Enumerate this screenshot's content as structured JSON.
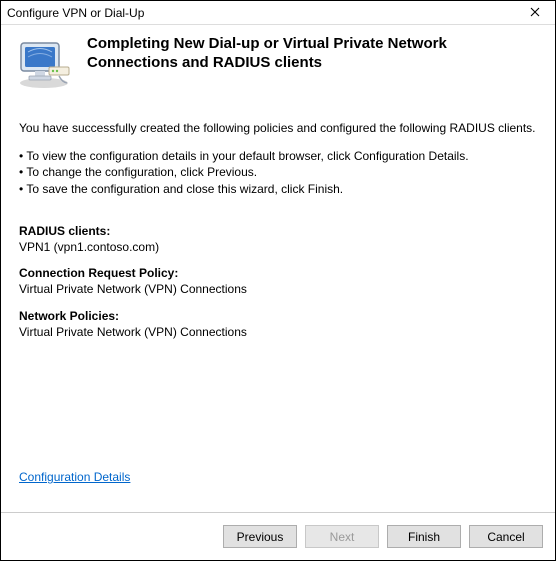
{
  "window": {
    "title": "Configure VPN or Dial-Up"
  },
  "header": {
    "heading": "Completing New Dial-up or Virtual Private Network Connections and RADIUS clients"
  },
  "body": {
    "intro": "You have successfully created the following policies and configured the following RADIUS clients.",
    "bullets": {
      "b1": " •  To view the configuration details in your default browser, click Configuration Details.",
      "b2": " •  To change the configuration, click Previous.",
      "b3": " •  To save the configuration and close this wizard, click Finish."
    },
    "radius_clients": {
      "label": "RADIUS clients:",
      "value": "VPN1 (vpn1.contoso.com)"
    },
    "crp": {
      "label": "Connection Request Policy:",
      "value": "Virtual Private Network (VPN) Connections"
    },
    "np": {
      "label": "Network Policies:",
      "value": "Virtual Private Network (VPN) Connections"
    },
    "config_link": "Configuration Details"
  },
  "buttons": {
    "previous": "Previous",
    "next": "Next",
    "finish": "Finish",
    "cancel": "Cancel"
  },
  "icons": {
    "wizard_icon": "monitor-network-icon",
    "close": "close-icon"
  }
}
